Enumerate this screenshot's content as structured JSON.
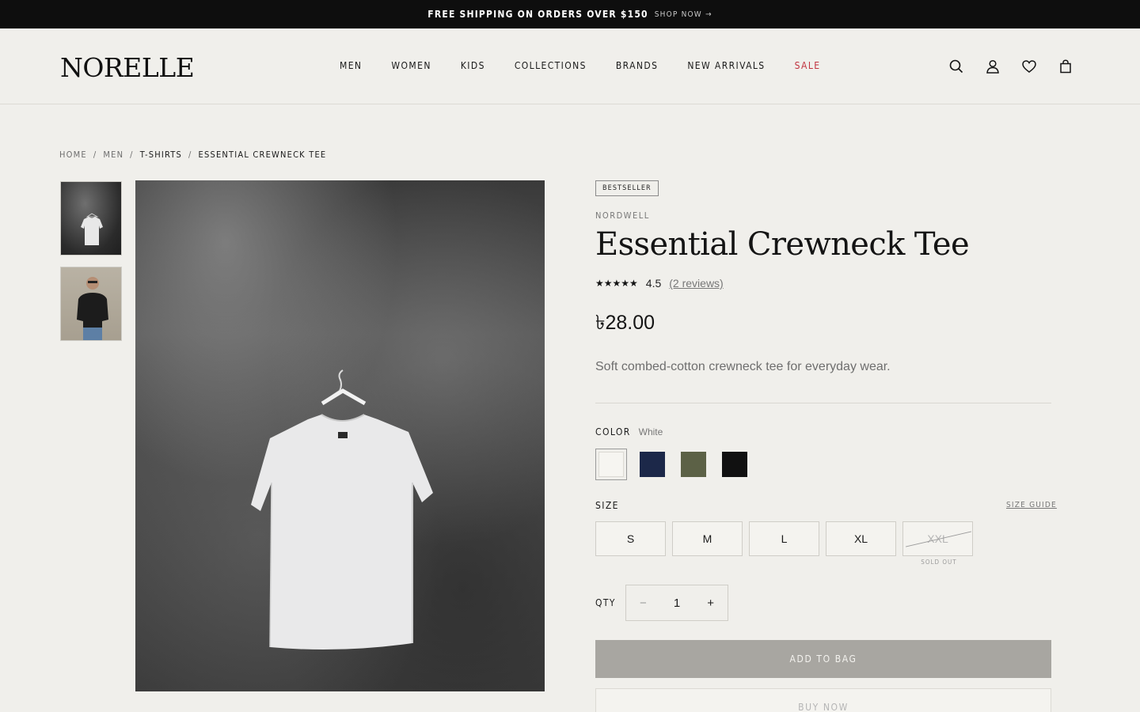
{
  "announcement": {
    "message": "FREE SHIPPING ON ORDERS OVER $150",
    "cta": "SHOP NOW →"
  },
  "header": {
    "logo": "NORELLE",
    "nav": [
      "MEN",
      "WOMEN",
      "KIDS",
      "COLLECTIONS",
      "BRANDS",
      "NEW ARRIVALS",
      "SALE"
    ],
    "icons": [
      "search-icon",
      "account-icon",
      "wishlist-heart-icon",
      "shopping-bag-icon"
    ]
  },
  "breadcrumb": [
    "HOME",
    "MEN",
    "T-SHIRTS",
    "ESSENTIAL CREWNECK TEE"
  ],
  "breadcrumb_separator": "/",
  "product": {
    "badge": "BESTSELLER",
    "brand": "NORDWELL",
    "title": "Essential Crewneck Tee",
    "stars": "★★★★★",
    "rating": "4.5",
    "reviews": "(2 reviews)",
    "price": "৳28.00",
    "description": "Soft combed-cotton crewneck tee for everyday wear.",
    "color_label": "COLOR",
    "selected_color": "White",
    "colors": [
      {
        "name": "White",
        "hex": "#f6f5f1",
        "selected": true
      },
      {
        "name": "Navy",
        "hex": "#1c2849",
        "selected": false
      },
      {
        "name": "Olive",
        "hex": "#5c6146",
        "selected": false
      },
      {
        "name": "Black",
        "hex": "#111111",
        "selected": false
      }
    ],
    "size_label": "SIZE",
    "size_guide": "SIZE GUIDE",
    "sizes": [
      {
        "label": "S",
        "available": true
      },
      {
        "label": "M",
        "available": true
      },
      {
        "label": "L",
        "available": true
      },
      {
        "label": "XL",
        "available": true
      },
      {
        "label": "XXL",
        "available": false
      }
    ],
    "sold_out_label": "SOLD OUT",
    "qty_label": "QTY",
    "qty": "1",
    "qty_minus": "−",
    "qty_plus": "+",
    "add_to_bag": "ADD TO BAG",
    "buy_now": "BUY NOW"
  }
}
